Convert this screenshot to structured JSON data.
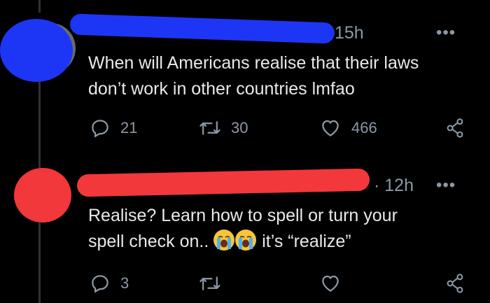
{
  "colors": {
    "background": "#000000",
    "text": "#e7e9ea",
    "muted": "#8b98a5",
    "redact_blue": "#1d36f5",
    "redact_red": "#f2383a"
  },
  "tweets": [
    {
      "time": "15h",
      "text_lines": [
        "When will Americans realise that their laws",
        "don’t work in other countries lmfao"
      ],
      "replies": "21",
      "retweets": "30",
      "likes": "466",
      "more_label": "•••"
    },
    {
      "time": "· 12h",
      "text_lines": [
        "Realise? Learn how to spell or turn your",
        "spell check on..",
        "it’s “realize”"
      ],
      "emoji": [
        "loudly-crying-face",
        "loudly-crying-face"
      ],
      "replies": "3",
      "retweets": "",
      "likes": "",
      "more_label": "•••"
    }
  ],
  "icons": [
    "reply-icon",
    "retweet-icon",
    "like-icon",
    "share-icon"
  ]
}
